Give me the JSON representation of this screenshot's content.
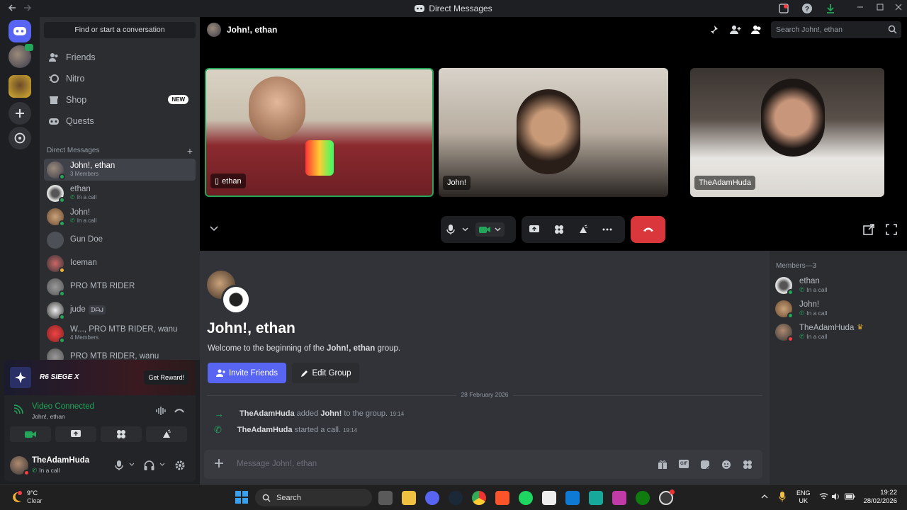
{
  "window": {
    "title": "Direct Messages"
  },
  "sidebar": {
    "search_label": "Find or start a conversation",
    "nav": [
      {
        "label": "Friends",
        "icon": "friends-icon"
      },
      {
        "label": "Nitro",
        "icon": "nitro-icon"
      },
      {
        "label": "Shop",
        "icon": "shop-icon",
        "badge": "NEW"
      },
      {
        "label": "Quests",
        "icon": "quests-icon"
      }
    ],
    "dm_header": "Direct Messages",
    "dms": [
      {
        "name": "John!, ethan",
        "sub": "3 Members"
      },
      {
        "name": "ethan",
        "sub": "In a call"
      },
      {
        "name": "John!",
        "sub": "In a call"
      },
      {
        "name": "Gun Doe",
        "sub": ""
      },
      {
        "name": "Iceman",
        "sub": ""
      },
      {
        "name": "PRO MTB RIDER",
        "sub": ""
      },
      {
        "name": "jude",
        "sub": "",
        "tag": "ᗪᗩᒍ"
      },
      {
        "name": "W..., PRO MTB RIDER, wanu",
        "sub": "4 Members"
      },
      {
        "name": "PRO MTB RIDER, wanu",
        "sub": ""
      }
    ]
  },
  "promo": {
    "game": "R6 SIEGE X",
    "button": "Get Reward!"
  },
  "voice": {
    "status": "Video Connected",
    "channel": "John!, ethan"
  },
  "user": {
    "name": "TheAdamHuda",
    "status": "In a call"
  },
  "header": {
    "title": "John!, ethan",
    "search_placeholder": "Search John!, ethan"
  },
  "call": {
    "tiles": [
      {
        "name": "ethan"
      },
      {
        "name": "John!"
      },
      {
        "name": "TheAdamHuda"
      }
    ]
  },
  "chat": {
    "title": "John!, ethan",
    "welcome_prefix": "Welcome to the beginning of the ",
    "welcome_bold": "John!, ethan",
    "welcome_suffix": " group.",
    "invite_label": "Invite Friends",
    "edit_label": "Edit Group",
    "date_divider": "28 February 2026",
    "events": [
      {
        "actor": "TheAdamHuda",
        "action": " added ",
        "target": "John!",
        "rest": " to the group.",
        "time": "19:14"
      },
      {
        "actor": "TheAdamHuda",
        "action": " started a call.",
        "target": "",
        "rest": "",
        "time": "19:14"
      }
    ],
    "input_placeholder": "Message John!, ethan"
  },
  "members": {
    "header": "Members—3",
    "list": [
      {
        "name": "ethan",
        "sub": "In a call"
      },
      {
        "name": "John!",
        "sub": "In a call"
      },
      {
        "name": "TheAdamHuda",
        "sub": "In a call"
      }
    ]
  },
  "taskbar": {
    "weather_temp": "9°C",
    "weather_desc": "Clear",
    "search_label": "Search",
    "lang1": "ENG",
    "lang2": "UK",
    "time": "19:22",
    "date": "28/02/2026"
  },
  "colors": {
    "accent": "#5865f2",
    "online": "#23a55a",
    "danger": "#da373c",
    "dnd": "#f23f43"
  }
}
